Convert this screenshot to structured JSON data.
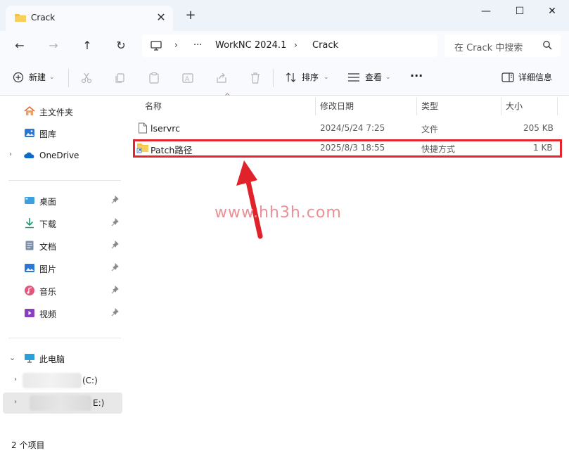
{
  "window": {
    "tab_title": "Crack",
    "new_tab": "+",
    "close_tab": "✕",
    "minimize": "—",
    "maximize": "☐",
    "close": "✕"
  },
  "address": {
    "overflow": "···",
    "crumbs": [
      "WorkNC 2024.1",
      "Crack"
    ],
    "separator": "›"
  },
  "search": {
    "placeholder": "在 Crack 中搜索"
  },
  "toolbar": {
    "new_label": "新建",
    "sort_label": "排序",
    "view_label": "查看",
    "more_label": "···",
    "details_label": "详细信息"
  },
  "sidebar": {
    "home": "主文件夹",
    "gallery": "图库",
    "onedrive": "OneDrive",
    "desktop": "桌面",
    "downloads": "下载",
    "documents": "文档",
    "pictures": "图片",
    "music": "音乐",
    "videos": "视频",
    "this_pc": "此电脑",
    "drive_c": "(C:)",
    "drive_e": "E:)"
  },
  "columns": {
    "name": "名称",
    "modified": "修改日期",
    "type": "类型",
    "size": "大小"
  },
  "files": [
    {
      "name": "lservrc",
      "modified": "2024/5/24 7:25",
      "type": "文件",
      "size": "205 KB",
      "icon": "file-icon"
    },
    {
      "name": "Patch路径",
      "modified": "2025/8/3 18:55",
      "type": "快捷方式",
      "size": "1 KB",
      "icon": "folder-shortcut-icon"
    }
  ],
  "watermark": "www.hh3h.com",
  "status": {
    "count": "2 个项目"
  },
  "colors": {
    "highlight": "#e5242b",
    "arrow": "#e0232a",
    "folder": "#f3c144"
  }
}
